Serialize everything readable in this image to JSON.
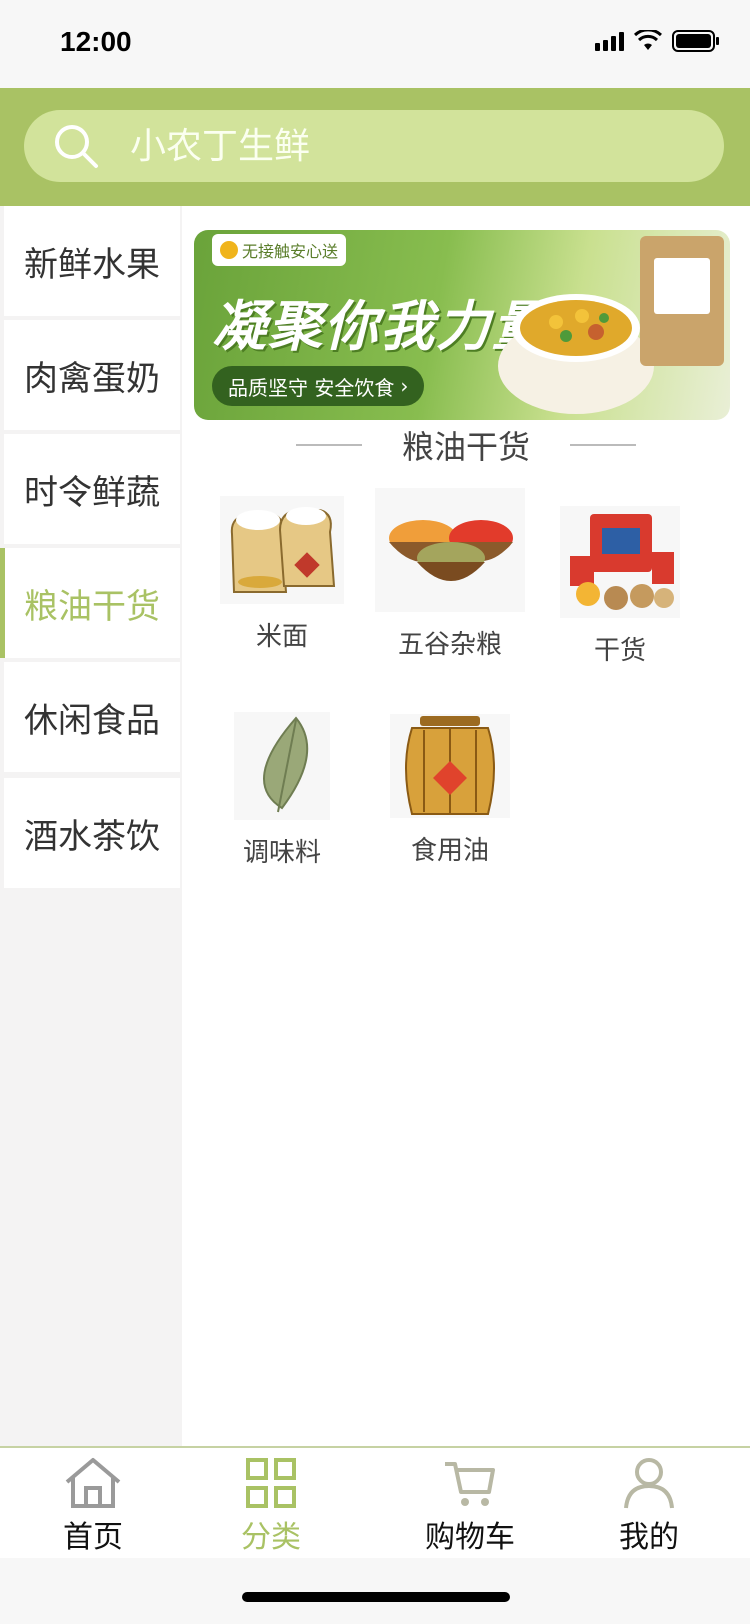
{
  "status_bar": {
    "time": "12:00"
  },
  "search": {
    "placeholder": "小农丁生鲜"
  },
  "sidebar": {
    "items": [
      {
        "label": "新鲜水果"
      },
      {
        "label": "肉禽蛋奶"
      },
      {
        "label": "时令鲜蔬"
      },
      {
        "label": "粮油干货",
        "active": true
      },
      {
        "label": "休闲食品"
      },
      {
        "label": "酒水茶饮"
      }
    ]
  },
  "banner": {
    "badge": "无接触安心送",
    "title": "凝聚你我力量",
    "pill": "品质坚守 安全饮食"
  },
  "section": {
    "title": "粮油干货"
  },
  "categories": [
    {
      "label": "米面",
      "icon": "flour-sacks-icon"
    },
    {
      "label": "五谷杂粮",
      "icon": "grain-bowls-icon"
    },
    {
      "label": "干货",
      "icon": "dried-goods-icon"
    },
    {
      "label": "调味料",
      "icon": "bay-leaf-icon"
    },
    {
      "label": "食用油",
      "icon": "oil-jar-icon"
    }
  ],
  "tabbar": {
    "items": [
      {
        "label": "首页",
        "icon": "home-icon"
      },
      {
        "label": "分类",
        "icon": "grid-icon",
        "active": true
      },
      {
        "label": "购物车",
        "icon": "cart-icon"
      },
      {
        "label": "我的",
        "icon": "user-icon"
      }
    ]
  },
  "colors": {
    "accent": "#a9c264",
    "search_bg": "#d2e39b",
    "sidebar_bg": "#f4f3f3"
  }
}
